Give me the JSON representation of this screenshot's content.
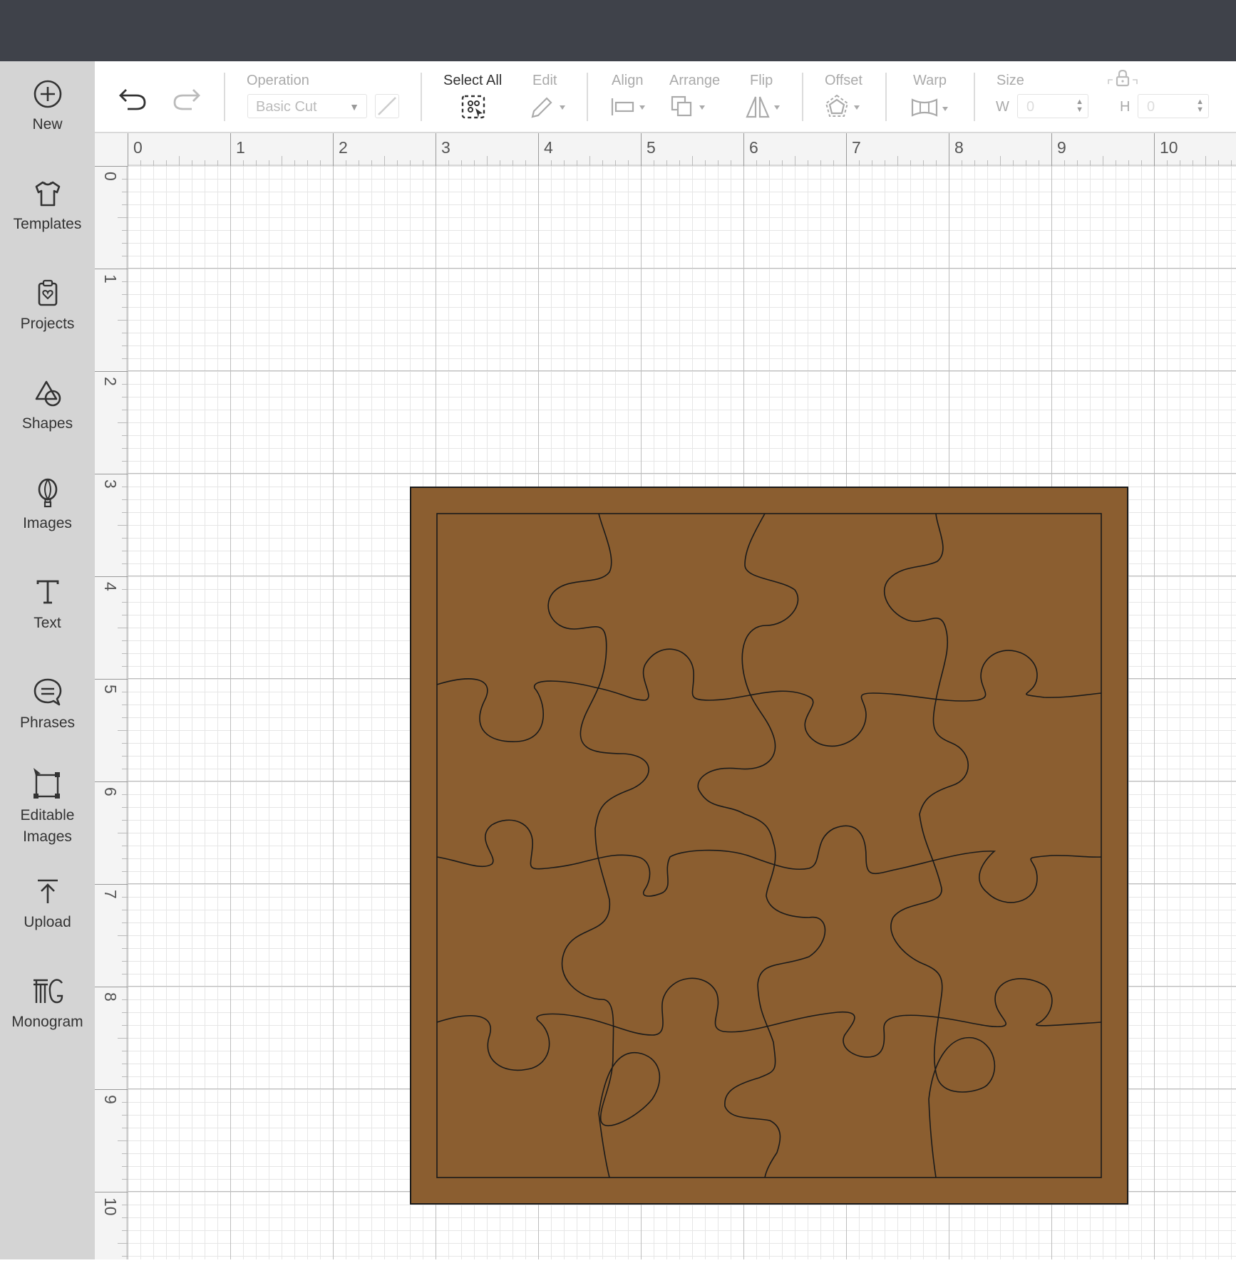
{
  "sidebar": {
    "items": [
      {
        "label": "New",
        "icon": "plus-circle-icon"
      },
      {
        "label": "Templates",
        "icon": "tshirt-icon"
      },
      {
        "label": "Projects",
        "icon": "clipboard-heart-icon"
      },
      {
        "label": "Shapes",
        "icon": "shapes-icon"
      },
      {
        "label": "Images",
        "icon": "balloon-icon"
      },
      {
        "label": "Text",
        "icon": "text-t-icon"
      },
      {
        "label": "Phrases",
        "icon": "speech-bubble-icon"
      },
      {
        "label": "Editable",
        "label2": "Images",
        "icon": "editable-images-icon"
      },
      {
        "label": "Upload",
        "icon": "upload-icon"
      },
      {
        "label": "Monogram",
        "icon": "monogram-icon"
      }
    ]
  },
  "toolbar": {
    "operation_label": "Operation",
    "operation_value": "Basic Cut",
    "select_all_label": "Select All",
    "edit_label": "Edit",
    "align_label": "Align",
    "arrange_label": "Arrange",
    "flip_label": "Flip",
    "offset_label": "Offset",
    "warp_label": "Warp",
    "size_label": "Size",
    "w_label": "W",
    "h_label": "H",
    "w_value": "0",
    "h_value": "0"
  },
  "rulers": {
    "top": [
      "0",
      "1",
      "2",
      "3",
      "4",
      "5",
      "6",
      "7",
      "8",
      "9",
      "10"
    ],
    "left": [
      "0",
      "1",
      "2",
      "3",
      "4",
      "5",
      "6",
      "7",
      "8",
      "9",
      "10"
    ]
  },
  "canvas": {
    "puzzle_fill": "#8B5E30",
    "puzzle_stroke": "#1a1a1a",
    "grid_major": "#bdbdbd",
    "grid_minor": "#e6e6e6"
  }
}
